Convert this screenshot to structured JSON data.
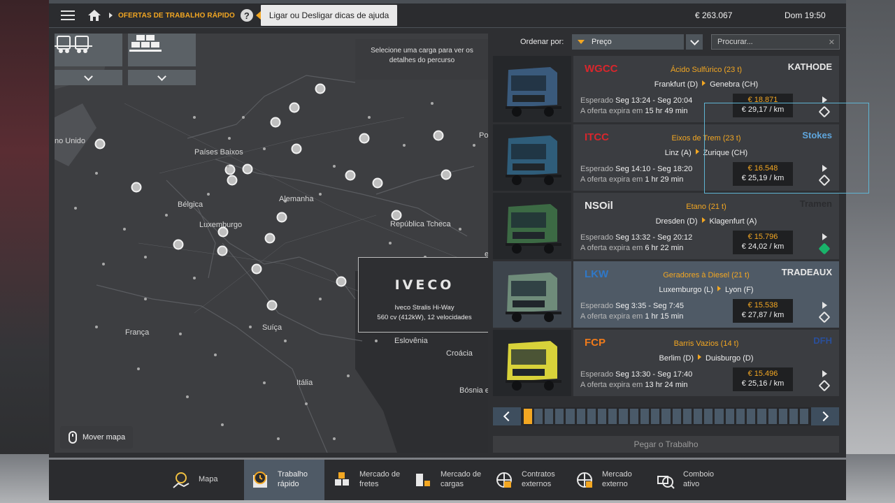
{
  "topbar": {
    "breadcrumb": "OFERTAS DE TRABALHO RÁPIDO",
    "help_label": "?",
    "help_tooltip": "Ligar ou Desligar dicas de ajuda",
    "money": "€ 263.067",
    "clock": "Dom 19:50"
  },
  "map": {
    "select_hint": "Selecione uma carga para ver os detalhes do percurso",
    "move_map": "Mover mapa",
    "labels": [
      "no Unido",
      "Países Baixos",
      "Bélgica",
      "Alemanha",
      "Luxemburgo",
      "República Tcheca",
      "França",
      "Suíça",
      "Eslovênia",
      "Croácia",
      "Itália",
      "Bósnia e",
      "Po",
      "e"
    ],
    "truck_card": {
      "brand": "IVECO",
      "model": "Iveco Stralis Hi-Way",
      "spec": "560 cv (412kW), 12 velocidades"
    }
  },
  "sort": {
    "label": "Ordenar por:",
    "value": "Preço",
    "search_placeholder": "Procurar..."
  },
  "jobs": [
    {
      "company": "WGCC",
      "company_color": "#d9262c",
      "cargo": "Ácido Sulfúrico (23 t)",
      "client": "KATHODE",
      "client_color": "#e8e8e8",
      "from": "Frankfurt (D)",
      "to": "Genebra (CH)",
      "expected_label": "Esperado",
      "expected": "Seg 13:24 - Seg 20:04",
      "expires_label": "A oferta expira em",
      "expires": "15 hr 49 min",
      "price": "€ 18.871",
      "per_km": "€ 29,17 / km",
      "truck_color": "#3a5a7c",
      "type_icon": "hazard-icon",
      "selected": false
    },
    {
      "company": "ITCC",
      "company_color": "#d9262c",
      "cargo": "Eixos de Trem (23 t)",
      "client": "Stokes",
      "client_color": "#5fa6dd",
      "from": "Linz (A)",
      "to": "Zurique (CH)",
      "expected_label": "Esperado",
      "expected": "Seg 14:10 - Seg 18:20",
      "expires_label": "A oferta expira em",
      "expires": "1 hr 29 min",
      "price": "€ 16.548",
      "per_km": "€ 25,19 / km",
      "truck_color": "#2f5d7a",
      "type_icon": "diamond-icon",
      "selected": false
    },
    {
      "company": "NSOil",
      "company_color": "#e8e8e8",
      "cargo": "Etano (21 t)",
      "client": "Tramen",
      "client_color": "#2b2c2f",
      "from": "Dresden (D)",
      "to": "Klagenfurt (A)",
      "expected_label": "Esperado",
      "expected": "Seg 13:32 - Seg 20:12",
      "expires_label": "A oferta expira em",
      "expires": "6 hr 22 min",
      "price": "€ 15.796",
      "per_km": "€ 24,02 / km",
      "truck_color": "#3c6a44",
      "type_icon": "special-cargo-icon",
      "selected": false
    },
    {
      "company": "LKW",
      "company_color": "#2f78c8",
      "cargo": "Geradores à Diesel (21 t)",
      "client": "TRADEAUX",
      "client_color": "#e8e8e8",
      "from": "Luxemburgo (L)",
      "to": "Lyon (F)",
      "expected_label": "Esperado",
      "expected": "Seg 3:35 - Seg 7:45",
      "expires_label": "A oferta expira em",
      "expires": "1 hr 15 min",
      "price": "€ 15.538",
      "per_km": "€ 27,87 / km",
      "truck_color": "#6f8c7a",
      "type_icon": "diamond-icon",
      "selected": true
    },
    {
      "company": "FCP",
      "company_color": "#f07a1a",
      "cargo": "Barris Vazios (14 t)",
      "client": "DFH",
      "client_color": "#2a4f9a",
      "from": "Berlim (D)",
      "to": "Duisburgo (D)",
      "expected_label": "Esperado",
      "expected": "Seg 13:30 - Seg 17:40",
      "expires_label": "A oferta expira em",
      "expires": "13 hr 24 min",
      "price": "€ 15.496",
      "per_km": "€ 25,16 / km",
      "truck_color": "#d8d23a",
      "type_icon": "container-icon",
      "selected": false
    }
  ],
  "pager": {
    "pages": 27,
    "active_page": 1
  },
  "take_job": "Pegar o Trabalho",
  "nav": [
    {
      "label": "Mapa",
      "icon": "map-icon",
      "active": false
    },
    {
      "label": "Trabalho rápido",
      "icon": "clock-icon",
      "active": true
    },
    {
      "label": "Mercado de fretes",
      "icon": "freight-market-icon",
      "active": false
    },
    {
      "label": "Mercado de cargas",
      "icon": "cargo-market-icon",
      "active": false
    },
    {
      "label": "Contratos externos",
      "icon": "external-contracts-icon",
      "active": false
    },
    {
      "label": "Mercado externo",
      "icon": "external-market-icon",
      "active": false
    },
    {
      "label": "Comboio ativo",
      "icon": "convoy-icon",
      "active": false
    }
  ]
}
